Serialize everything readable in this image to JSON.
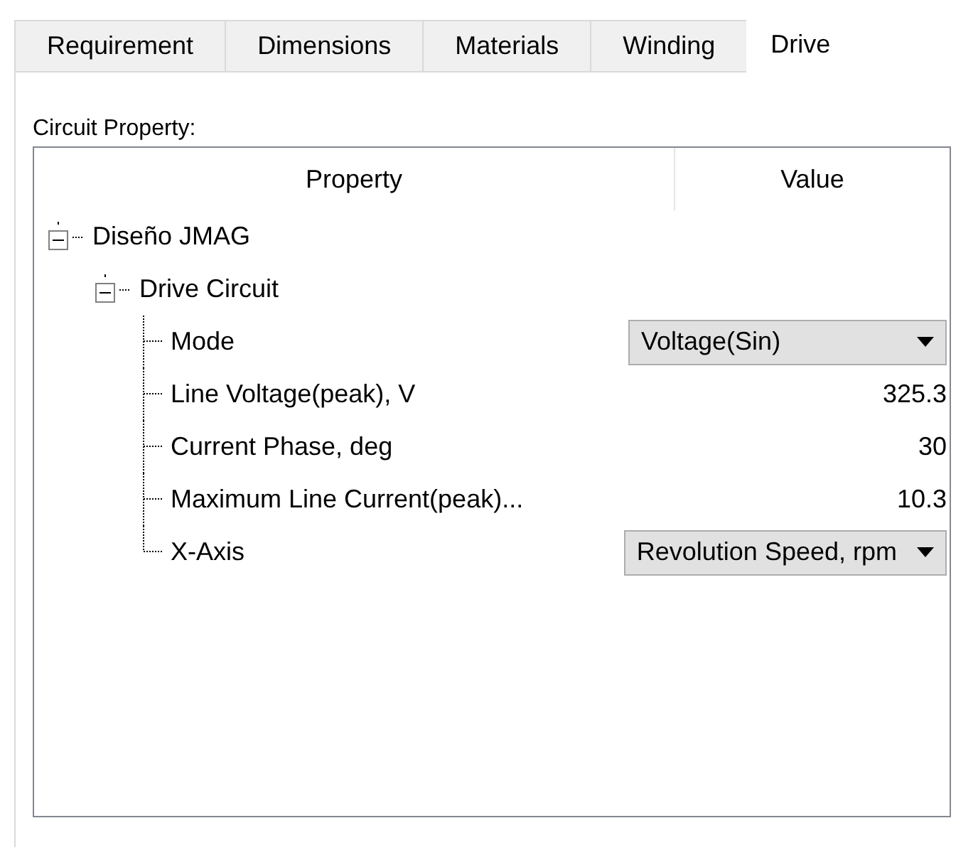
{
  "tabs": [
    {
      "label": "Requirement",
      "selected": false
    },
    {
      "label": "Dimensions",
      "selected": false
    },
    {
      "label": "Materials",
      "selected": false
    },
    {
      "label": "Winding",
      "selected": false
    },
    {
      "label": "Drive",
      "selected": true
    }
  ],
  "group_label": "Circuit Property:",
  "grid": {
    "columns": [
      "Property",
      "Value"
    ],
    "tree": [
      {
        "label": "Diseño JMAG",
        "expanded": true,
        "children": [
          {
            "label": "Drive Circuit",
            "expanded": true,
            "children": [
              {
                "label": "Mode",
                "kind": "dropdown",
                "value": "Voltage(Sin)"
              },
              {
                "label": "Line Voltage(peak), V",
                "kind": "number",
                "value": "325.3"
              },
              {
                "label": "Current Phase, deg",
                "kind": "number",
                "value": "30"
              },
              {
                "label": "Maximum Line Current(peak)...",
                "kind": "number",
                "value": "10.3"
              },
              {
                "label": "X-Axis",
                "kind": "dropdown",
                "value": "Revolution Speed, rpm"
              }
            ]
          }
        ]
      }
    ]
  }
}
